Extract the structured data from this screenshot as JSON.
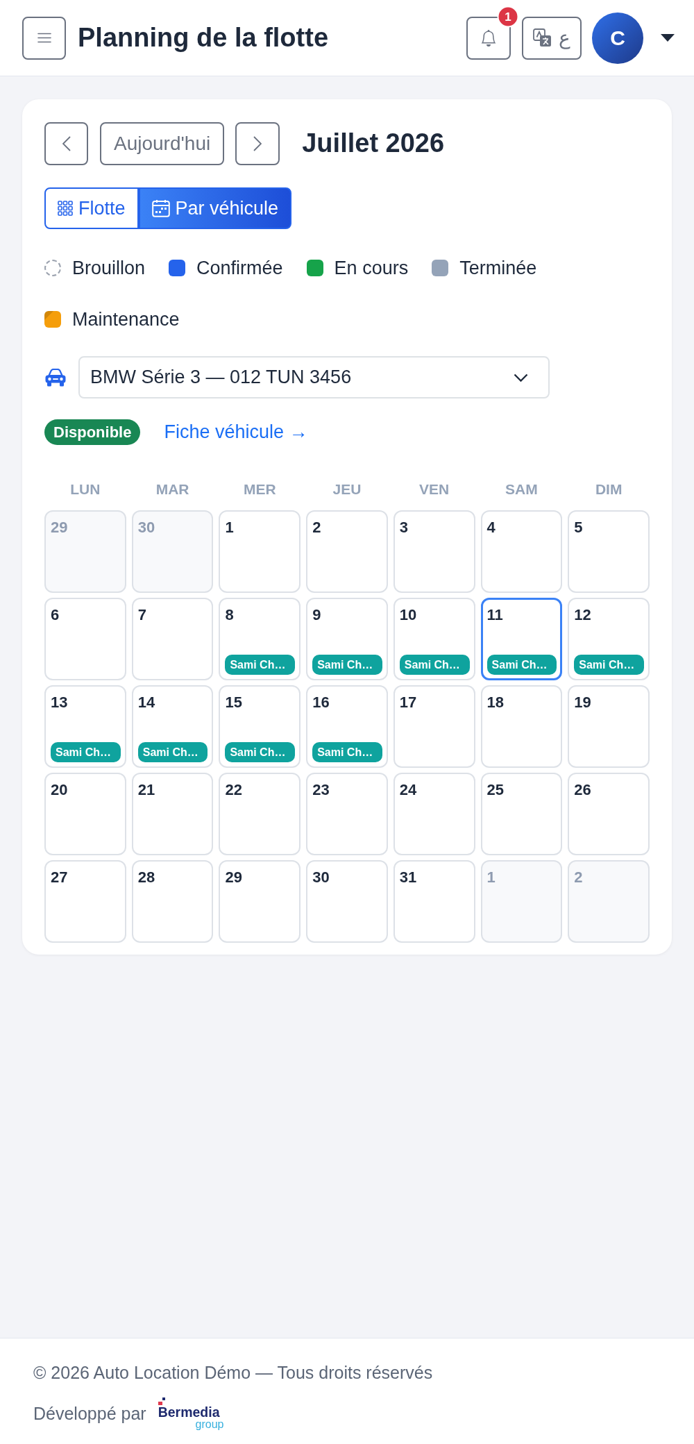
{
  "header": {
    "title": "Planning de la flotte",
    "notification_count": "1",
    "language_button": "ع",
    "avatar_initial": "C"
  },
  "toolbar": {
    "today_button": "Aujourd'hui",
    "month": "Juillet 2026"
  },
  "view_toggle": [
    {
      "label": "Flotte",
      "selected": false
    },
    {
      "label": "Par véhicule",
      "selected": true
    }
  ],
  "legend": [
    {
      "label": "Brouillon",
      "kind": "outline",
      "color": "#9ca3af"
    },
    {
      "label": "Confirmée",
      "kind": "solid",
      "color": "#2563eb"
    },
    {
      "label": "En cours",
      "kind": "solid",
      "color": "#16a34a"
    },
    {
      "label": "Terminée",
      "kind": "solid",
      "color": "#94a3b8"
    },
    {
      "label": "Maintenance",
      "kind": "hatched",
      "color": "#f59e0b"
    }
  ],
  "vehicle": {
    "value": "BMW Série 3 — 012 TUN 3456",
    "status": "Disponible",
    "link": "Fiche véhicule →"
  },
  "calendar": {
    "weekdays": [
      "LUN",
      "MAR",
      "MER",
      "JEU",
      "VEN",
      "SAM",
      "DIM"
    ],
    "weeks": [
      {
        "days": [
          {
            "day": "29",
            "outside": true,
            "today": false
          },
          {
            "day": "30",
            "outside": true,
            "today": false
          },
          {
            "day": "1",
            "outside": false,
            "today": false
          },
          {
            "day": "2",
            "outside": false,
            "today": false
          },
          {
            "day": "3",
            "outside": false,
            "today": false
          },
          {
            "day": "4",
            "outside": false,
            "today": false
          },
          {
            "day": "5",
            "outside": false,
            "today": false
          }
        ]
      },
      {
        "days": [
          {
            "day": "6",
            "outside": false,
            "today": false
          },
          {
            "day": "7",
            "outside": false,
            "today": false
          },
          {
            "day": "8",
            "outside": false,
            "today": false,
            "events": [
              {
                "label": "Sami Ch…"
              }
            ]
          },
          {
            "day": "9",
            "outside": false,
            "today": false,
            "events": [
              {
                "label": "Sami Ch…"
              }
            ]
          },
          {
            "day": "10",
            "outside": false,
            "today": false,
            "events": [
              {
                "label": "Sami Ch…"
              }
            ]
          },
          {
            "day": "11",
            "outside": false,
            "today": true,
            "events": [
              {
                "label": "Sami Ch…"
              }
            ]
          },
          {
            "day": "12",
            "outside": false,
            "today": false,
            "events": [
              {
                "label": "Sami Ch…"
              }
            ]
          }
        ]
      },
      {
        "days": [
          {
            "day": "13",
            "outside": false,
            "today": false,
            "events": [
              {
                "label": "Sami Ch…"
              }
            ]
          },
          {
            "day": "14",
            "outside": false,
            "today": false,
            "events": [
              {
                "label": "Sami Ch…"
              }
            ]
          },
          {
            "day": "15",
            "outside": false,
            "today": false,
            "events": [
              {
                "label": "Sami Ch…"
              }
            ]
          },
          {
            "day": "16",
            "outside": false,
            "today": false,
            "events": [
              {
                "label": "Sami Ch…"
              }
            ]
          },
          {
            "day": "17",
            "outside": false,
            "today": false
          },
          {
            "day": "18",
            "outside": false,
            "today": false
          },
          {
            "day": "19",
            "outside": false,
            "today": false
          }
        ]
      },
      {
        "days": [
          {
            "day": "20",
            "outside": false,
            "today": false
          },
          {
            "day": "21",
            "outside": false,
            "today": false
          },
          {
            "day": "22",
            "outside": false,
            "today": false
          },
          {
            "day": "23",
            "outside": false,
            "today": false
          },
          {
            "day": "24",
            "outside": false,
            "today": false
          },
          {
            "day": "25",
            "outside": false,
            "today": false
          },
          {
            "day": "26",
            "outside": false,
            "today": false
          }
        ]
      },
      {
        "days": [
          {
            "day": "27",
            "outside": false,
            "today": false
          },
          {
            "day": "28",
            "outside": false,
            "today": false
          },
          {
            "day": "29",
            "outside": false,
            "today": false
          },
          {
            "day": "30",
            "outside": false,
            "today": false
          },
          {
            "day": "31",
            "outside": false,
            "today": false
          },
          {
            "day": "1",
            "outside": true,
            "today": false
          },
          {
            "day": "2",
            "outside": true,
            "today": false
          }
        ]
      }
    ]
  },
  "footer": {
    "copyright": "© 2026 Auto Location Démo — Tous droits réservés",
    "credit": "Développé par",
    "logo_name": "Bermedia",
    "logo_tagline": "group"
  }
}
